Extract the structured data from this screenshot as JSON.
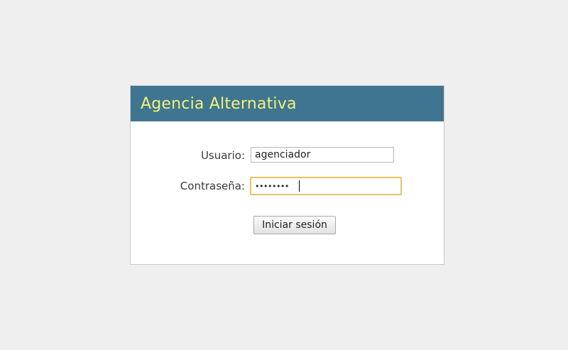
{
  "header": {
    "title": "Agencia Alternativa"
  },
  "form": {
    "username_label": "Usuario:",
    "username_value": "agenciador",
    "password_label": "Contraseña:",
    "password_value": "agencias",
    "submit_label": "Iniciar sesión"
  },
  "colors": {
    "header_background": "#3f7590",
    "title_text": "#f2f27a",
    "focus_border": "#e7c46b",
    "page_background": "#efefef"
  }
}
